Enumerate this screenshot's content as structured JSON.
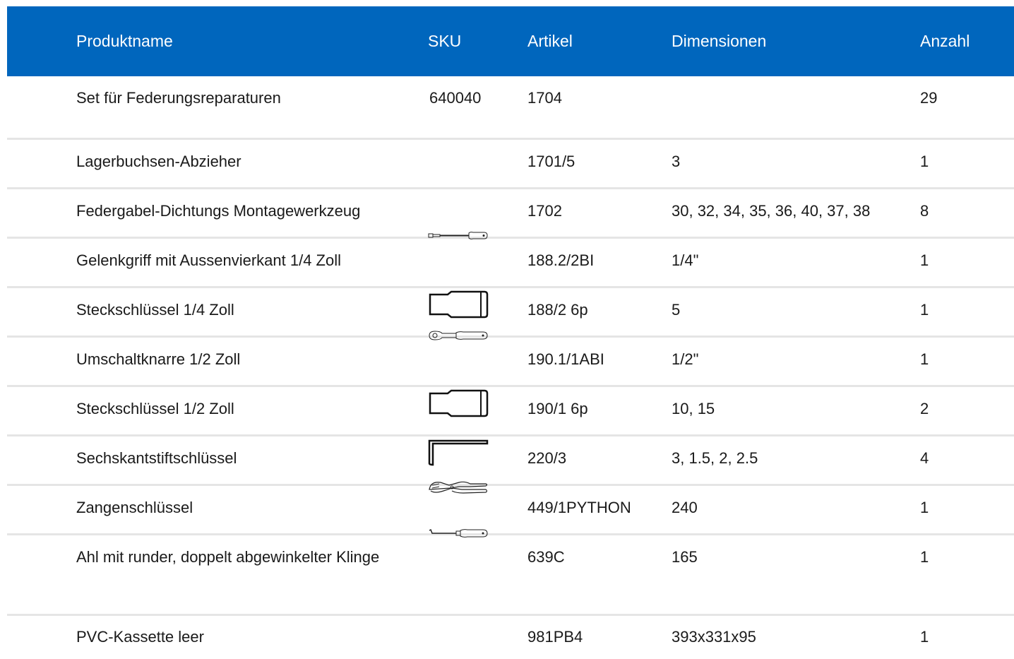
{
  "headers": {
    "name": "Produktname",
    "sku": "SKU",
    "article": "Artikel",
    "dimensions": "Dimensionen",
    "quantity": "Anzahl"
  },
  "rows": [
    {
      "name": "Set für Federungsreparaturen",
      "sku": "640040",
      "article": "1704",
      "dimensions": "",
      "quantity": "29",
      "icon": ""
    },
    {
      "name": "Lagerbuchsen-Abzieher",
      "sku": "",
      "article": "1701/5",
      "dimensions": "3",
      "quantity": "1",
      "icon": ""
    },
    {
      "name": "Federgabel-Dichtungs Montagewerkzeug",
      "sku": "",
      "article": "1702",
      "dimensions": "30, 32, 34, 35, 36, 40, 37, 38",
      "quantity": "8",
      "icon": ""
    },
    {
      "name": "Gelenkgriff mit Aussenvierkant 1/4 Zoll",
      "sku": "",
      "article": "188.2/2BI",
      "dimensions": "1/4\"",
      "quantity": "1",
      "icon": "hinge-handle-icon"
    },
    {
      "name": "Steckschlüssel 1/4 Zoll",
      "sku": "",
      "article": "188/2 6p",
      "dimensions": "5",
      "quantity": "1",
      "icon": "socket-icon"
    },
    {
      "name": "Umschaltknarre 1/2 Zoll",
      "sku": "",
      "article": "190.1/1ABI",
      "dimensions": "1/2\"",
      "quantity": "1",
      "icon": "ratchet-icon"
    },
    {
      "name": "Steckschlüssel 1/2 Zoll",
      "sku": "",
      "article": "190/1 6p",
      "dimensions": "10, 15",
      "quantity": "2",
      "icon": "socket-icon"
    },
    {
      "name": "Sechskantstiftschlüssel",
      "sku": "",
      "article": "220/3",
      "dimensions": "3, 1.5, 2, 2.5",
      "quantity": "4",
      "icon": "hex-key-icon"
    },
    {
      "name": "Zangenschlüssel",
      "sku": "",
      "article": "449/1PYTHON",
      "dimensions": "240",
      "quantity": "1",
      "icon": "pliers-wrench-icon"
    },
    {
      "name": "Ahl mit runder, doppelt abgewinkelter Klinge",
      "sku": "",
      "article": "639C",
      "dimensions": "165",
      "quantity": "1",
      "icon": "awl-icon"
    },
    {
      "name": "PVC-Kassette leer",
      "sku": "",
      "article": "981PB4",
      "dimensions": "393x331x95",
      "quantity": "1",
      "icon": ""
    }
  ],
  "colors": {
    "header_bg": "#0066bd",
    "header_text": "#ffffff",
    "row_divider": "#e5e5e5"
  }
}
